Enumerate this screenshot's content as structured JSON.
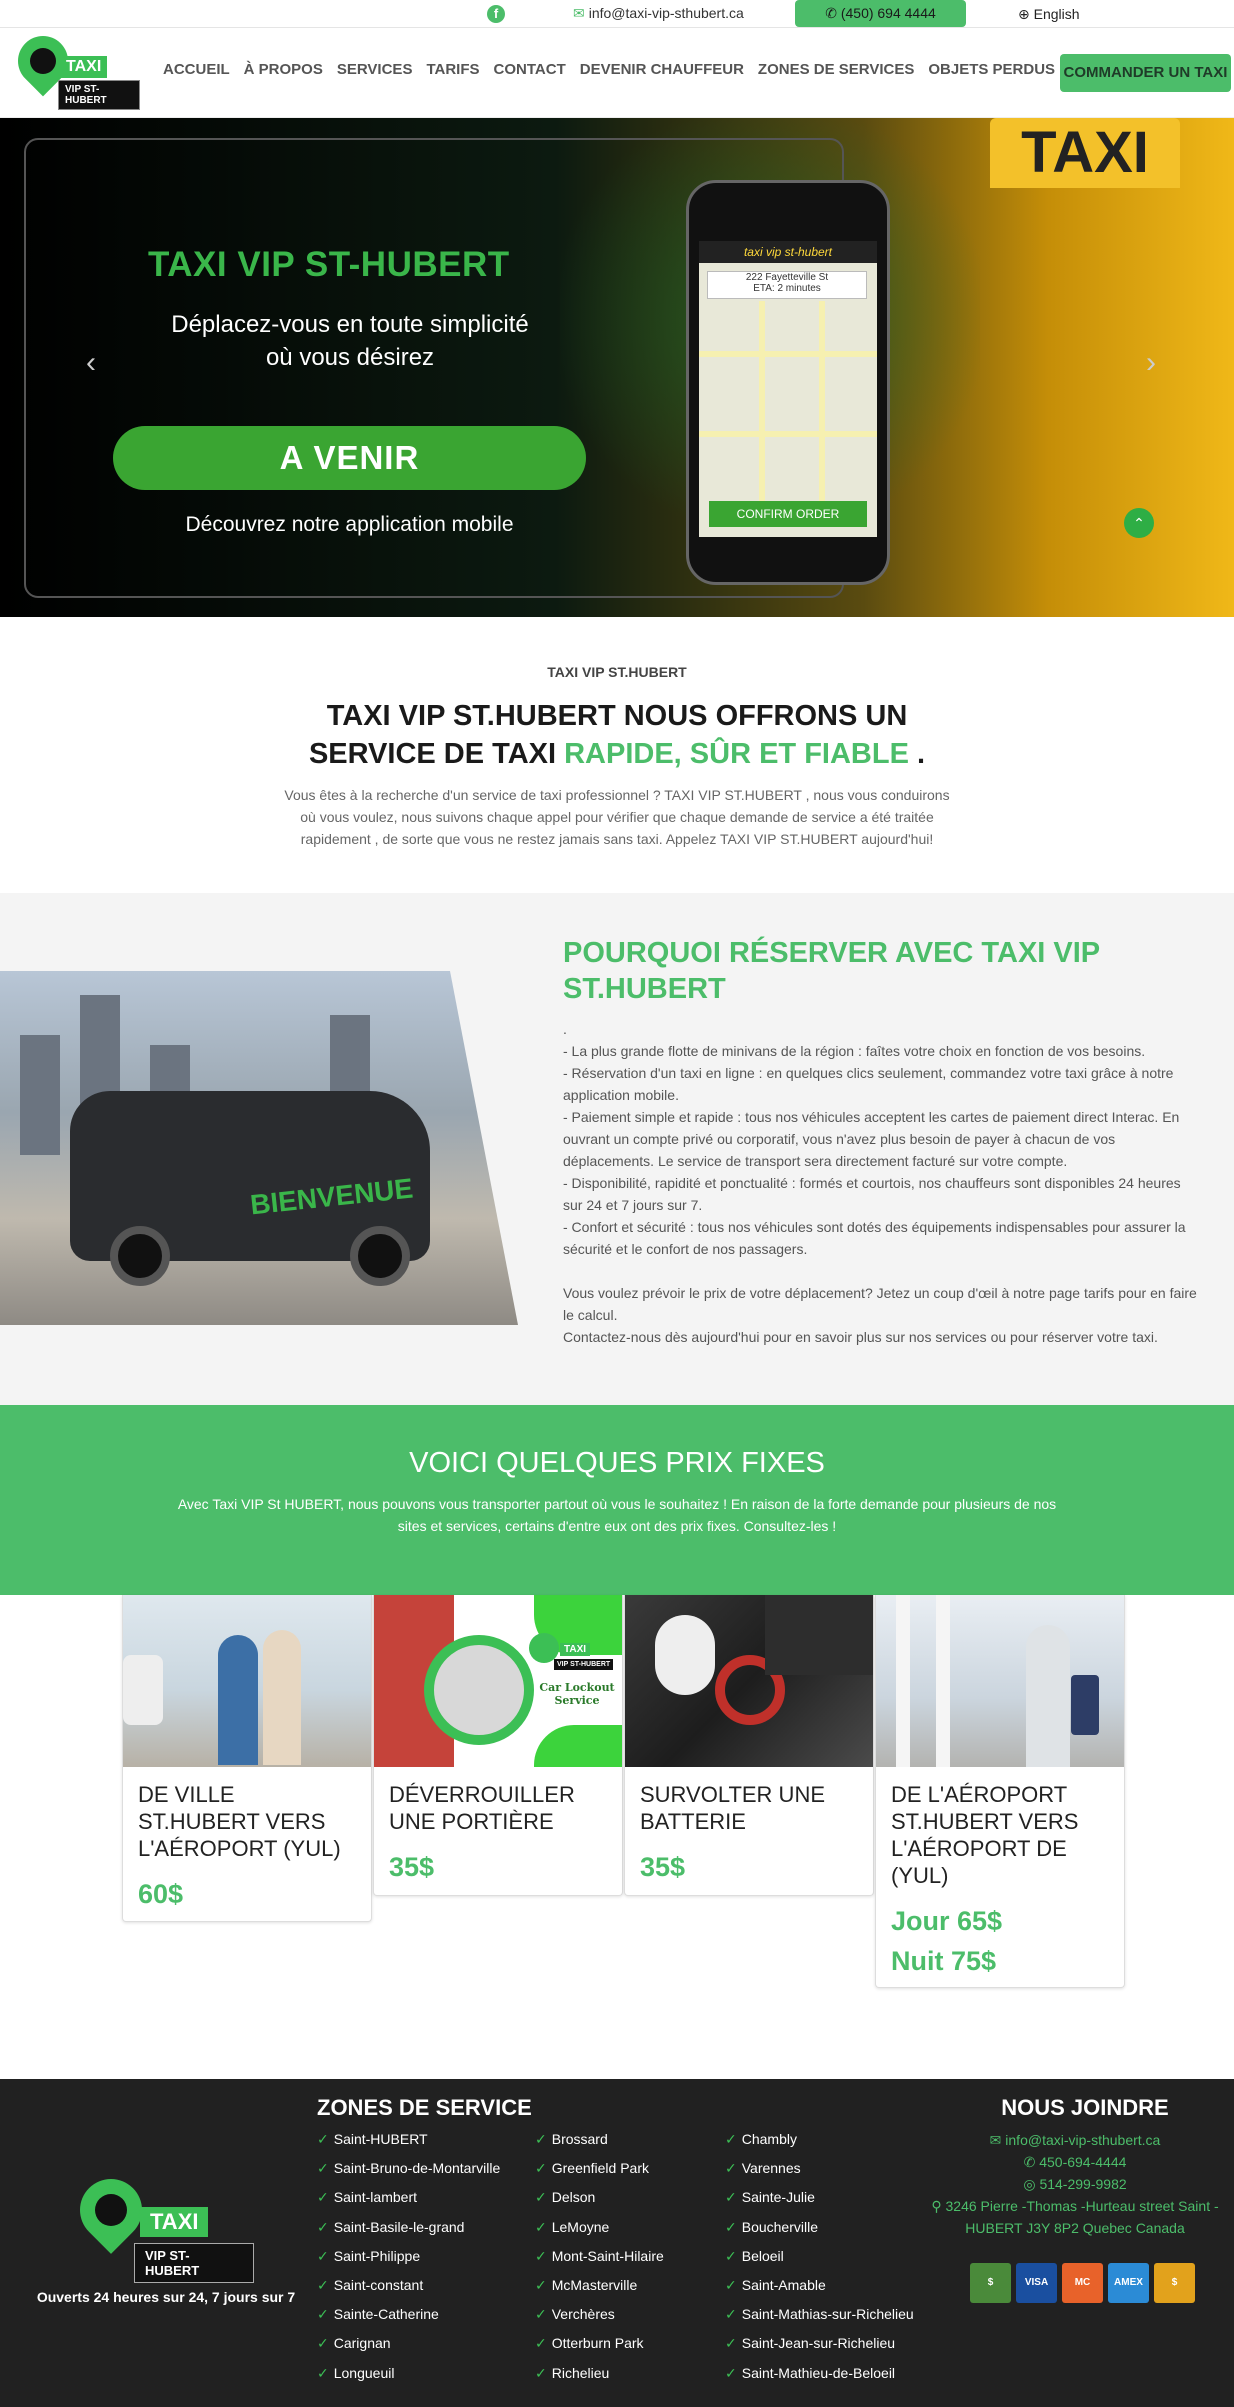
{
  "topbar": {
    "facebook_icon": "facebook-icon",
    "email": "info@taxi-vip-sthubert.ca",
    "phone": "(450) 694 4444",
    "language": "English"
  },
  "nav": {
    "logo_taxi": "TAXI",
    "logo_sub": "VIP ST-HUBERT",
    "items": [
      "ACCUEIL",
      "À PROPOS",
      "SERVICES",
      "TARIFS",
      "CONTACT",
      "DEVENIR CHAUFFEUR",
      "ZONES DE SERVICES",
      "OBJETS PERDUS"
    ],
    "cta": "COMMANDER UN TAXI"
  },
  "hero": {
    "title": "TAXI VIP ST-HUBERT",
    "subtitle_line1": "Déplacez-vous en toute simplicité",
    "subtitle_line2": "où vous désirez",
    "button": "A VENIR",
    "app_text": "Découvrez notre application mobile",
    "phone_app_name": "taxi vip st-hubert",
    "phone_address": "222 Fayetteville St",
    "phone_eta": "ETA: 2 minutes",
    "phone_confirm": "CONFIRM ORDER",
    "sign": "TAXI"
  },
  "intro": {
    "kicker": "TAXI VIP ST.HUBERT",
    "title_a": "TAXI VIP ST.HUBERT NOUS OFFRONS UN SERVICE DE TAXI ",
    "title_green": "RAPIDE, SÛR ET FIABLE",
    "title_end": " .",
    "paragraph": "Vous êtes à la recherche d'un service de taxi professionnel ? TAXI VIP ST.HUBERT , nous vous conduirons où vous voulez, nous suivons chaque appel pour vérifier que chaque demande de service a été traitée rapidement , de sorte que vous ne restez jamais sans taxi. Appelez TAXI VIP ST.HUBERT aujourd'hui!"
  },
  "why": {
    "title": "POURQUOI RÉSERVER AVEC TAXI VIP ST.HUBERT",
    "van_text": "BIENVENUE",
    "lines": [
      ".",
      "- La plus grande flotte de minivans de la région : faîtes votre choix en fonction de vos besoins.",
      "- Réservation d'un taxi en ligne : en quelques clics seulement, commandez votre taxi grâce à notre application mobile.",
      "- Paiement simple et rapide : tous nos véhicules acceptent les cartes de paiement direct Interac. En ouvrant un compte privé ou corporatif, vous n'avez plus besoin de payer à chacun de vos déplacements. Le service de transport sera directement facturé sur votre compte.",
      "- Disponibilité, rapidité et ponctualité : formés et courtois, nos chauffeurs sont disponibles 24 heures sur 24 et 7 jours sur 7.",
      "- Confort et sécurité : tous nos véhicules sont dotés des équipements indispensables pour assurer la sécurité et le confort de nos passagers.",
      "",
      "Vous voulez prévoir le prix de votre déplacement? Jetez un coup d'œil à notre page tarifs pour en faire le calcul.",
      "Contactez-nous dès aujourd'hui pour en savoir plus sur nos services ou pour réserver votre taxi."
    ]
  },
  "prices": {
    "title": "VOICI QUELQUES PRIX FIXES",
    "text": "Avec Taxi VIP St HUBERT, nous pouvons vous transporter partout où vous le souhaitez ! En raison de la forte demande pour plusieurs de nos sites et services, certains d'entre eux ont des prix fixes. Consultez-les !",
    "cards": [
      {
        "title": "DE VILLE ST.HUBERT VERS L'AÉROPORT (YUL)",
        "price": "60$"
      },
      {
        "title": "DÉVERROUILLER UNE PORTIÈRE",
        "price": "35$",
        "badge_taxi": "TAXI",
        "badge_sub": "VIP ST-HUBERT",
        "badge_text": "Car Lockout Service"
      },
      {
        "title": "SURVOLTER UNE BATTERIE",
        "price": "35$"
      },
      {
        "title": "DE L'AÉROPORT ST.HUBERT VERS L'AÉROPORT DE (YUL)",
        "price": "Jour 65$",
        "price2": "Nuit 75$"
      }
    ]
  },
  "footer": {
    "logo_taxi": "TAXI",
    "logo_sub": "VIP ST-HUBERT",
    "hours": "Ouverts 24 heures sur 24, 7 jours sur 7",
    "zones_title": "ZONES DE SERVICE",
    "zones_col1": [
      "Saint-HUBERT",
      "Saint-Bruno-de-Montarville",
      "Saint-lambert",
      "Saint-Basile-le-grand",
      "Saint-Philippe",
      "Saint-constant",
      "Sainte-Catherine",
      "Carignan",
      "Longueuil"
    ],
    "zones_col2": [
      "Brossard",
      "Greenfield Park",
      "Delson",
      "LeMoyne",
      "Mont-Saint-Hilaire",
      "McMasterville",
      "Verchères",
      "Otterburn Park",
      "Richelieu"
    ],
    "zones_col3": [
      "Chambly",
      "Varennes",
      "Sainte-Julie",
      "Boucherville",
      "Beloeil",
      "Saint-Amable",
      "Saint-Mathias-sur-Richelieu",
      "Saint-Jean-sur-Richelieu",
      "Saint-Mathieu-de-Beloeil"
    ],
    "join_title": "NOUS JOINDRE",
    "email": "info@taxi-vip-sthubert.ca",
    "phone1": "450-694-4444",
    "phone2": "514-299-9982",
    "address": "3246 Pierre -Thomas -Hurteau street Saint - HUBERT J3Y 8P2 Quebec Canada",
    "cards": [
      "$",
      "VISA",
      "MC",
      "AMEX",
      "$"
    ]
  },
  "colors": {
    "brand_green": "#4cbd6a",
    "footer_bg": "#212121"
  }
}
